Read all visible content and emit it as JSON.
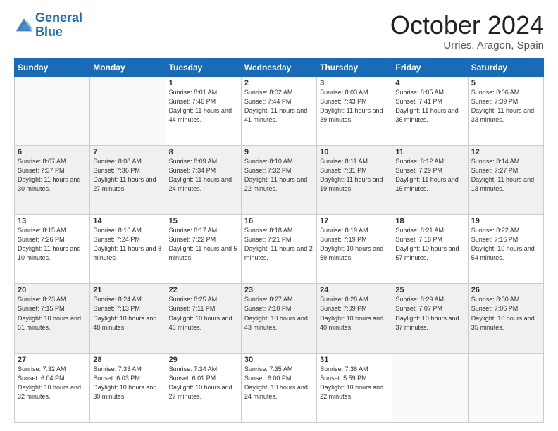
{
  "header": {
    "logo_line1": "General",
    "logo_line2": "Blue",
    "month": "October 2024",
    "location": "Urries, Aragon, Spain"
  },
  "days_of_week": [
    "Sunday",
    "Monday",
    "Tuesday",
    "Wednesday",
    "Thursday",
    "Friday",
    "Saturday"
  ],
  "weeks": [
    [
      {
        "day": "",
        "info": ""
      },
      {
        "day": "",
        "info": ""
      },
      {
        "day": "1",
        "info": "Sunrise: 8:01 AM\nSunset: 7:46 PM\nDaylight: 11 hours and 44 minutes."
      },
      {
        "day": "2",
        "info": "Sunrise: 8:02 AM\nSunset: 7:44 PM\nDaylight: 11 hours and 41 minutes."
      },
      {
        "day": "3",
        "info": "Sunrise: 8:03 AM\nSunset: 7:43 PM\nDaylight: 11 hours and 39 minutes."
      },
      {
        "day": "4",
        "info": "Sunrise: 8:05 AM\nSunset: 7:41 PM\nDaylight: 11 hours and 36 minutes."
      },
      {
        "day": "5",
        "info": "Sunrise: 8:06 AM\nSunset: 7:39 PM\nDaylight: 11 hours and 33 minutes."
      }
    ],
    [
      {
        "day": "6",
        "info": "Sunrise: 8:07 AM\nSunset: 7:37 PM\nDaylight: 11 hours and 30 minutes."
      },
      {
        "day": "7",
        "info": "Sunrise: 8:08 AM\nSunset: 7:36 PM\nDaylight: 11 hours and 27 minutes."
      },
      {
        "day": "8",
        "info": "Sunrise: 8:09 AM\nSunset: 7:34 PM\nDaylight: 11 hours and 24 minutes."
      },
      {
        "day": "9",
        "info": "Sunrise: 8:10 AM\nSunset: 7:32 PM\nDaylight: 11 hours and 22 minutes."
      },
      {
        "day": "10",
        "info": "Sunrise: 8:11 AM\nSunset: 7:31 PM\nDaylight: 11 hours and 19 minutes."
      },
      {
        "day": "11",
        "info": "Sunrise: 8:12 AM\nSunset: 7:29 PM\nDaylight: 11 hours and 16 minutes."
      },
      {
        "day": "12",
        "info": "Sunrise: 8:14 AM\nSunset: 7:27 PM\nDaylight: 11 hours and 13 minutes."
      }
    ],
    [
      {
        "day": "13",
        "info": "Sunrise: 8:15 AM\nSunset: 7:26 PM\nDaylight: 11 hours and 10 minutes."
      },
      {
        "day": "14",
        "info": "Sunrise: 8:16 AM\nSunset: 7:24 PM\nDaylight: 11 hours and 8 minutes."
      },
      {
        "day": "15",
        "info": "Sunrise: 8:17 AM\nSunset: 7:22 PM\nDaylight: 11 hours and 5 minutes."
      },
      {
        "day": "16",
        "info": "Sunrise: 8:18 AM\nSunset: 7:21 PM\nDaylight: 11 hours and 2 minutes."
      },
      {
        "day": "17",
        "info": "Sunrise: 8:19 AM\nSunset: 7:19 PM\nDaylight: 10 hours and 59 minutes."
      },
      {
        "day": "18",
        "info": "Sunrise: 8:21 AM\nSunset: 7:18 PM\nDaylight: 10 hours and 57 minutes."
      },
      {
        "day": "19",
        "info": "Sunrise: 8:22 AM\nSunset: 7:16 PM\nDaylight: 10 hours and 54 minutes."
      }
    ],
    [
      {
        "day": "20",
        "info": "Sunrise: 8:23 AM\nSunset: 7:15 PM\nDaylight: 10 hours and 51 minutes."
      },
      {
        "day": "21",
        "info": "Sunrise: 8:24 AM\nSunset: 7:13 PM\nDaylight: 10 hours and 48 minutes."
      },
      {
        "day": "22",
        "info": "Sunrise: 8:25 AM\nSunset: 7:11 PM\nDaylight: 10 hours and 46 minutes."
      },
      {
        "day": "23",
        "info": "Sunrise: 8:27 AM\nSunset: 7:10 PM\nDaylight: 10 hours and 43 minutes."
      },
      {
        "day": "24",
        "info": "Sunrise: 8:28 AM\nSunset: 7:09 PM\nDaylight: 10 hours and 40 minutes."
      },
      {
        "day": "25",
        "info": "Sunrise: 8:29 AM\nSunset: 7:07 PM\nDaylight: 10 hours and 37 minutes."
      },
      {
        "day": "26",
        "info": "Sunrise: 8:30 AM\nSunset: 7:06 PM\nDaylight: 10 hours and 35 minutes."
      }
    ],
    [
      {
        "day": "27",
        "info": "Sunrise: 7:32 AM\nSunset: 6:04 PM\nDaylight: 10 hours and 32 minutes."
      },
      {
        "day": "28",
        "info": "Sunrise: 7:33 AM\nSunset: 6:03 PM\nDaylight: 10 hours and 30 minutes."
      },
      {
        "day": "29",
        "info": "Sunrise: 7:34 AM\nSunset: 6:01 PM\nDaylight: 10 hours and 27 minutes."
      },
      {
        "day": "30",
        "info": "Sunrise: 7:35 AM\nSunset: 6:00 PM\nDaylight: 10 hours and 24 minutes."
      },
      {
        "day": "31",
        "info": "Sunrise: 7:36 AM\nSunset: 5:59 PM\nDaylight: 10 hours and 22 minutes."
      },
      {
        "day": "",
        "info": ""
      },
      {
        "day": "",
        "info": ""
      }
    ]
  ]
}
